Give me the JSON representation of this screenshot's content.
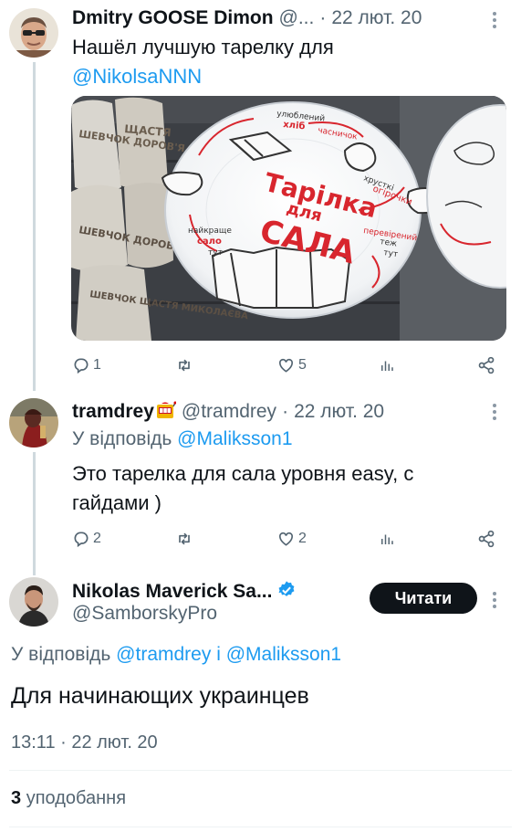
{
  "tweets": [
    {
      "name": "Dmitry GOOSE Dimon",
      "handle": "@...",
      "sep": "·",
      "time": "22 лют. 20",
      "text_line1": "Нашёл лучшую тарелку для",
      "text_mention": "@NikolsaNNN",
      "image_text": {
        "title1": "Тарілка",
        "title2": "для",
        "title3": "САЛА",
        "label_bread": "хліб",
        "label_bread_top": "улюблений",
        "label_garlic": "часничок",
        "label_cucumbers": "огірочки",
        "label_cucumbers_top": "хрусткі",
        "label_best": "найкраще",
        "label_salo": "сало",
        "label_here": "тут",
        "label_checked": "перевірений",
        "label_too": "теж",
        "label_here2": "тут",
        "bag1": "ШЕВЧОК ДОРОВ'Я",
        "bag2": "ЩАСТЯ",
        "bag3": "ШЕВЧОК ЩАСТЯ МИКОЛАЄВА"
      },
      "actions": {
        "reply": "1",
        "retweet": "",
        "like": "5"
      }
    },
    {
      "name": "tramdrey",
      "handle": "@tramdrey",
      "sep": "·",
      "time": "22 лют. 20",
      "reply_prefix": "У відповідь",
      "reply_to": "@Maliksson1",
      "text": "Это тарелка для сала уровня easy, с гайдами )",
      "actions": {
        "reply": "2",
        "retweet": "",
        "like": "2"
      }
    },
    {
      "name": "Nikolas Maverick Sa...",
      "handle": "@SamborskyPro",
      "follow_label": "Читати",
      "reply_prefix": "У відповідь",
      "reply_to_1": "@tramdrey",
      "reply_and": "і",
      "reply_to_2": "@Maliksson1",
      "text": "Для начинающих украинцев",
      "timestamp": "13:11 · 22 лют. 20",
      "likes_count": "3",
      "likes_label": "уподобання"
    }
  ],
  "colors": {
    "link": "#1d9bf0",
    "muted": "#536471",
    "verified": "#1d9bf0",
    "plate_red": "#d8262e"
  }
}
